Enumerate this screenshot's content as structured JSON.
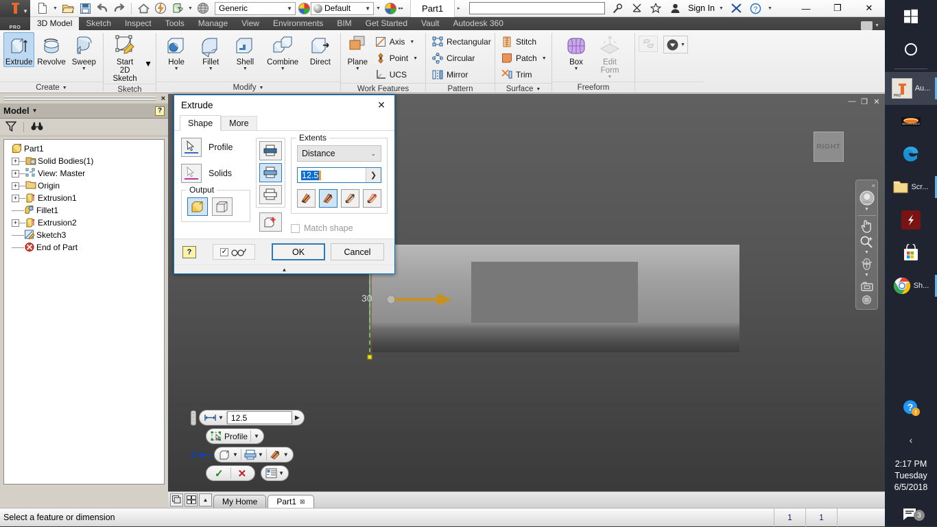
{
  "app": {
    "title": "Part1",
    "quick_access": {
      "material_value": "Generic",
      "visual_style_value": "Default",
      "search_placeholder": "",
      "sign_in_label": "Sign In"
    },
    "window_controls": {
      "minimize": "—",
      "restore": "❐",
      "close": "✕"
    }
  },
  "ribbon": {
    "pro_badge": "PRO",
    "tabs": [
      {
        "label": "3D Model",
        "active": true
      },
      {
        "label": "Sketch",
        "active": false
      },
      {
        "label": "Inspect",
        "active": false
      },
      {
        "label": "Tools",
        "active": false
      },
      {
        "label": "Manage",
        "active": false
      },
      {
        "label": "View",
        "active": false
      },
      {
        "label": "Environments",
        "active": false
      },
      {
        "label": "BIM",
        "active": false
      },
      {
        "label": "Get Started",
        "active": false
      },
      {
        "label": "Vault",
        "active": false
      },
      {
        "label": "Autodesk 360",
        "active": false
      }
    ],
    "panels": [
      {
        "title": "Create",
        "has_dropdown": true,
        "buttons": [
          {
            "label": "Extrude",
            "selected": true,
            "has_caret": false
          },
          {
            "label": "Revolve",
            "selected": false,
            "has_caret": false
          },
          {
            "label": "Sweep",
            "selected": false,
            "has_caret": true
          }
        ]
      },
      {
        "title": "Sketch",
        "has_dropdown": false,
        "buttons": [
          {
            "label": "Start\n2D Sketch",
            "selected": false,
            "has_caret": true
          }
        ]
      },
      {
        "title": "Modify",
        "has_dropdown": true,
        "buttons": [
          {
            "label": "Hole",
            "selected": false,
            "has_caret": true
          },
          {
            "label": "Fillet",
            "selected": false,
            "has_caret": true
          },
          {
            "label": "Shell",
            "selected": false,
            "has_caret": true
          },
          {
            "label": "Combine",
            "selected": false,
            "has_caret": true
          },
          {
            "label": "Direct",
            "selected": false,
            "has_caret": false
          }
        ]
      },
      {
        "title": "Work Features",
        "has_dropdown": false,
        "buttons": [
          {
            "label": "Plane",
            "selected": false,
            "has_caret": true
          }
        ],
        "small": [
          {
            "label": "Axis",
            "has_caret": true
          },
          {
            "label": "Point",
            "has_caret": true
          },
          {
            "label": "UCS",
            "has_caret": false
          }
        ]
      },
      {
        "title": "Pattern",
        "has_dropdown": false,
        "small": [
          {
            "label": "Rectangular",
            "has_caret": false
          },
          {
            "label": "Circular",
            "has_caret": false
          },
          {
            "label": "Mirror",
            "has_caret": false
          }
        ]
      },
      {
        "title": "Surface",
        "has_dropdown": true,
        "small": [
          {
            "label": "Stitch",
            "has_caret": false
          },
          {
            "label": "Patch",
            "has_caret": true
          },
          {
            "label": "Trim",
            "has_caret": false
          }
        ]
      },
      {
        "title": "Freeform",
        "has_dropdown": false,
        "buttons": [
          {
            "label": "Box",
            "selected": false,
            "has_caret": true
          },
          {
            "label": "Edit\nForm",
            "selected": false,
            "has_caret": true,
            "disabled": true
          }
        ]
      }
    ]
  },
  "browser": {
    "panel_title": "Model",
    "help_glyph": "?",
    "filter_icon": "filter-icon",
    "find_icon": "binoculars-icon",
    "tree": [
      {
        "label": "Part1",
        "icon": "part-icon",
        "expander": "none",
        "indent": 0
      },
      {
        "label": "Solid Bodies(1)",
        "icon": "solid-bodies-icon",
        "expander": "plus",
        "indent": 1
      },
      {
        "label": "View: Master",
        "icon": "view-master-icon",
        "expander": "plus",
        "indent": 1
      },
      {
        "label": "Origin",
        "icon": "folder-icon",
        "expander": "plus",
        "indent": 1
      },
      {
        "label": "Extrusion1",
        "icon": "extrusion-icon",
        "expander": "plus",
        "indent": 1
      },
      {
        "label": "Fillet1",
        "icon": "fillet-icon",
        "expander": "none",
        "indent": 1
      },
      {
        "label": "Extrusion2",
        "icon": "extrusion-icon",
        "expander": "plus",
        "indent": 1
      },
      {
        "label": "Sketch3",
        "icon": "sketch-icon",
        "expander": "none",
        "indent": 1
      },
      {
        "label": "End of Part",
        "icon": "end-of-part-icon",
        "expander": "none",
        "indent": 1
      }
    ]
  },
  "extrude_dialog": {
    "title": "Extrude",
    "close_glyph": "✕",
    "tabs": [
      {
        "label": "Shape",
        "active": true
      },
      {
        "label": "More",
        "active": false
      }
    ],
    "shape": {
      "profile_label": "Profile",
      "solids_label": "Solids",
      "output_group_label": "Output",
      "output_options": [
        {
          "name": "solid-output",
          "selected": true
        },
        {
          "name": "surface-output",
          "selected": false
        }
      ],
      "operations": [
        {
          "name": "join-operation",
          "selected": false
        },
        {
          "name": "cut-operation",
          "selected": true
        },
        {
          "name": "intersect-operation",
          "selected": false
        },
        {
          "name": "new-solid-operation",
          "selected": false
        }
      ]
    },
    "extents": {
      "group_label": "Extents",
      "type_value": "Distance",
      "distance_value": "12.5",
      "directions": [
        {
          "name": "direction-1",
          "selected": false
        },
        {
          "name": "direction-2",
          "selected": true
        },
        {
          "name": "direction-symmetric",
          "selected": false
        },
        {
          "name": "direction-asymmetric",
          "selected": false
        }
      ],
      "match_shape_label": "Match shape",
      "match_shape_checked": false
    },
    "footer": {
      "help_glyph": "?",
      "preview_checked": true,
      "ok_label": "OK",
      "cancel_label": "Cancel"
    }
  },
  "mini_toolbar": {
    "distance_value": "12.5",
    "profile_label": "Profile",
    "axis_label": "Z",
    "accept_glyph": "✓",
    "cancel_glyph": "✕"
  },
  "viewport": {
    "dimension_label": "30",
    "view_cube_label": "RIGHT",
    "nav_items": [
      "steering-wheel-icon",
      "pan-icon",
      "zoom-icon",
      "orbit-icon",
      "look-at-icon"
    ],
    "doc_window_controls": {
      "minimize": "—",
      "restore": "❐",
      "close": "✕"
    }
  },
  "bottom_tabs": {
    "tabs": [
      {
        "label": "My Home",
        "active": false,
        "closable": false
      },
      {
        "label": "Part1",
        "active": true,
        "closable": true
      }
    ]
  },
  "statusbar": {
    "message": "Select a feature or dimension",
    "cells": [
      "1",
      "1"
    ]
  },
  "taskbar": {
    "items": [
      {
        "name": "start-button",
        "label": "",
        "icon": "windows-logo-icon"
      },
      {
        "name": "cortana-button",
        "label": "",
        "icon": "cortana-circle-icon"
      },
      {
        "name": "inventor-task",
        "label": "Au...",
        "icon": "inventor-icon",
        "active": true
      },
      {
        "name": "cheetah-task",
        "label": "",
        "icon": "cheetah-icon"
      },
      {
        "name": "edge-task",
        "label": "",
        "icon": "edge-icon"
      },
      {
        "name": "folder-task",
        "label": "Scr...",
        "icon": "folder-icon",
        "running": true
      },
      {
        "name": "flash-task",
        "label": "",
        "icon": "flash-icon"
      },
      {
        "name": "store-task",
        "label": "",
        "icon": "store-icon"
      },
      {
        "name": "chrome-task",
        "label": "Sh...",
        "icon": "chrome-icon",
        "running": true
      }
    ],
    "tray": {
      "help_icon": "help-alert-icon",
      "chevron": "‹",
      "time": "2:17 PM",
      "day": "Tuesday",
      "date": "6/5/2018",
      "action_center_icon": "action-center-icon",
      "notification_count": "3"
    }
  }
}
